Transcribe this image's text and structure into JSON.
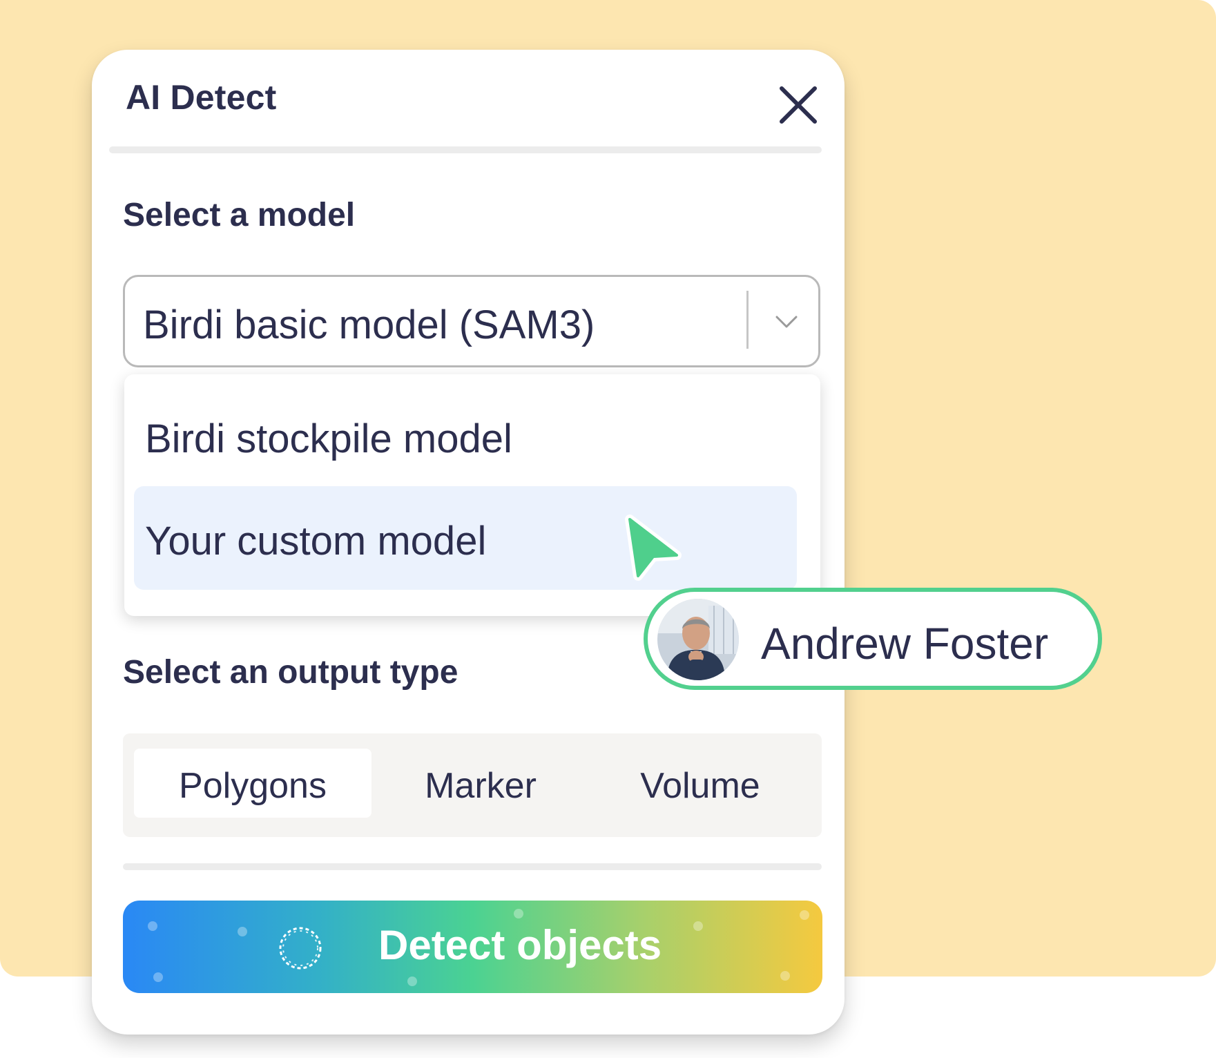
{
  "panel": {
    "title": "AI Detect"
  },
  "model": {
    "section_label": "Select a model",
    "selected": "Birdi basic model (SAM3)",
    "options": [
      {
        "label": "Birdi stockpile model",
        "highlighted": false
      },
      {
        "label": "Your custom model",
        "highlighted": true
      }
    ]
  },
  "output": {
    "section_label": "Select an output type",
    "options": [
      {
        "label": "Polygons",
        "active": true
      },
      {
        "label": "Marker",
        "active": false
      },
      {
        "label": "Volume",
        "active": false
      }
    ]
  },
  "action": {
    "detect_label": "Detect objects"
  },
  "user": {
    "name": "Andrew Foster"
  },
  "icons": {
    "close": "close-icon",
    "chevron": "chevron-down-icon",
    "spinner": "spinner-icon",
    "cursor": "pointer-cursor-icon"
  },
  "colors": {
    "background": "#fde6b0",
    "text": "#2c2e4e",
    "highlight": "#ebf2fd",
    "accent_green": "#52d08e",
    "gradient_start": "#2a88f5",
    "gradient_end": "#f5c93f"
  }
}
